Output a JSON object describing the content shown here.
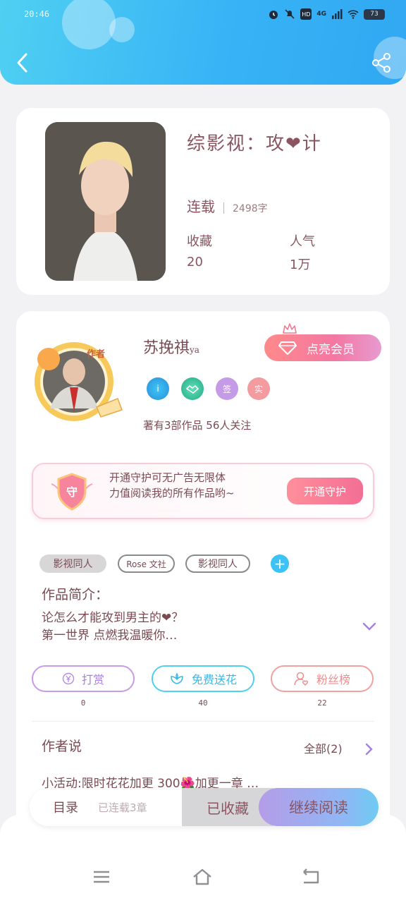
{
  "status_bar": {
    "time": "20:46",
    "network": "4G",
    "battery": "73"
  },
  "book": {
    "title": "综影视：攻❤计",
    "status": "连载",
    "word_count": "2498字",
    "collect_label": "收藏",
    "collect_value": "20",
    "popularity_label": "人气",
    "popularity_value": "1万"
  },
  "author": {
    "name": "苏挽祺",
    "name_suffix": "ya",
    "avatar_tag": "作者",
    "vip_button": "点亮会员",
    "badges": [
      "i",
      "",
      "签",
      "实"
    ],
    "stats": "著有3部作品 56人关注"
  },
  "guard": {
    "shield_label": "守",
    "line1": "开通守护可无广告无限体",
    "line2": "力值阅读我的所有作品哟~",
    "button": "开通守护"
  },
  "tags": [
    "影视同人",
    "Rose 文社",
    "影视同人"
  ],
  "tag_add": "+",
  "intro": {
    "title": "作品简介：",
    "line1": "论怎么才能攻到男主的❤？",
    "line2": "第一世界 点燃我温暖你…"
  },
  "actions": [
    {
      "label": "打赏",
      "count": "0",
      "icon": "yen-icon"
    },
    {
      "label": "免费送花",
      "count": "40",
      "icon": "flower-icon"
    },
    {
      "label": "粉丝榜",
      "count": "22",
      "icon": "fans-icon"
    }
  ],
  "author_says": {
    "title": "作者说",
    "all_label": "全部(2)",
    "activity": "小活动:限时花花加更 300🌺加更一章 …"
  },
  "bottom_bar": {
    "toc": "目录",
    "serial_status": "已连载3章",
    "collected": "已收藏",
    "continue": "继续阅读"
  },
  "colors": {
    "header": "#38b3f6",
    "accent_pink": "#f377a3",
    "text": "#7a4b52"
  }
}
